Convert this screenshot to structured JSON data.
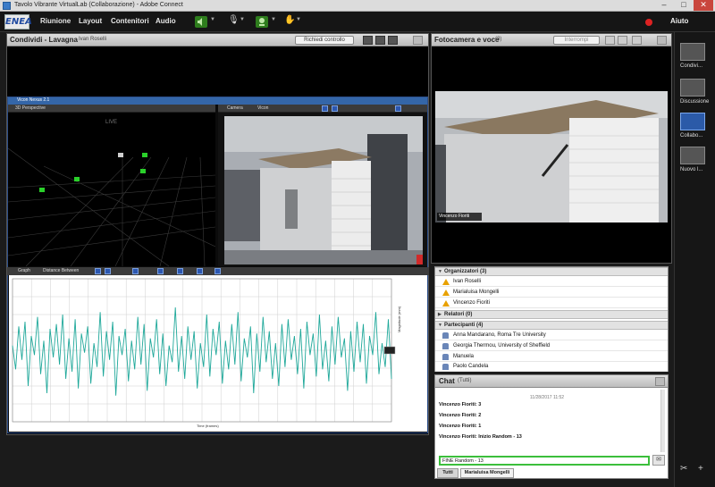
{
  "window": {
    "title": "Tavolo Vibrante VirtualLab (Collaborazione) - Adobe Connect",
    "minimize": "–",
    "maximize": "□",
    "close": "✕"
  },
  "menubar": {
    "logo": "ENEA",
    "items": [
      "Riunione",
      "Layout",
      "Contenitori",
      "Audio"
    ],
    "help": "Aiuto"
  },
  "share_pod": {
    "title": "Condividi - Lavagna",
    "presenter": "Ivan Roselli",
    "control_button": "Richiedi controllo",
    "inner_app": {
      "title": "Vicon Nexus 2.1",
      "view_left_label": "3D Perspective",
      "view_right_label": "Camera",
      "view_right_sub": "Vicon",
      "live_label": "LIVE",
      "chart_bar_label": "Graph",
      "chart_bar_sub": "Distance Between"
    }
  },
  "camera_pod": {
    "title": "Fotocamera e voce",
    "count": "(3)",
    "stop_label": "Interrompi",
    "speaker_name": "Vincenzo Fioriti"
  },
  "attendees": {
    "hosts_label": "Organizzatori (3)",
    "hosts": [
      "Ivan Roselli",
      "Marialuisa Mongelli",
      "Vincenzo Fioriti"
    ],
    "presenters_label": "Relatori (0)",
    "participants_label": "Partecipanti (4)",
    "participants": [
      "Anna Mandarano, Roma Tre University",
      "Georgia Thermou, University of Sheffield",
      "Manuela",
      "Paolo Candela"
    ]
  },
  "chat": {
    "title": "Chat",
    "subtitle": "(Tutti)",
    "date": "11/28/2017 11:52",
    "messages": [
      {
        "author": "Vincenzo Fioriti",
        "text": "3"
      },
      {
        "author": "Vincenzo Fioriti",
        "text": "2"
      },
      {
        "author": "Vincenzo Fioriti",
        "text": "1"
      },
      {
        "author": "Vincenzo Fioriti",
        "text": "Inizio Random - 13"
      }
    ],
    "input_value": "FINE Random - 13",
    "tabs": [
      "Tutti",
      "Marialuisa Mongelli"
    ]
  },
  "layouts": [
    {
      "label": "Condivi..."
    },
    {
      "label": "Discussione"
    },
    {
      "label": "Collabo...",
      "active": true
    },
    {
      "label": "Nuovo l..."
    }
  ],
  "chart_data": {
    "type": "line",
    "title": "",
    "xlabel": "Time (frames)",
    "ylabel": "Magnitude (mm)",
    "series_color": "#1fa89a",
    "ylim": [
      -30,
      30
    ],
    "note": "waveform approximated; signal oscillating around 0 with amplitude ~±20",
    "series": [
      {
        "values": [
          2,
          -8,
          10,
          -4,
          12,
          -15,
          6,
          -2,
          14,
          -10,
          4,
          -18,
          9,
          -3,
          11,
          -6,
          15,
          -12,
          5,
          -9,
          13,
          -16,
          7,
          -1,
          10,
          -14,
          3,
          -7,
          16,
          -11,
          8,
          -4,
          12,
          -19,
          6,
          -2,
          9,
          -13,
          4,
          -8,
          14,
          -6,
          11,
          -17,
          5,
          -3,
          13,
          -10,
          7,
          -15,
          2,
          -5,
          18,
          -9,
          6,
          -12,
          10,
          -4,
          8,
          -16,
          3,
          -7,
          15,
          -11,
          9,
          -2,
          12,
          -14,
          4,
          -8,
          11,
          -6,
          16,
          -13,
          5,
          -3,
          10,
          -18,
          7,
          -9,
          14,
          -5,
          8,
          -12,
          3,
          -15,
          11,
          -7,
          13,
          -4,
          6,
          -10,
          9,
          -16,
          12,
          -2,
          7,
          -11,
          15,
          -8,
          4,
          -13,
          10,
          -6,
          14,
          -3,
          5,
          -17,
          8,
          -9,
          12,
          -5,
          11,
          -14,
          6,
          -2,
          16,
          -10,
          3,
          -7,
          13,
          -12
        ]
      }
    ]
  }
}
